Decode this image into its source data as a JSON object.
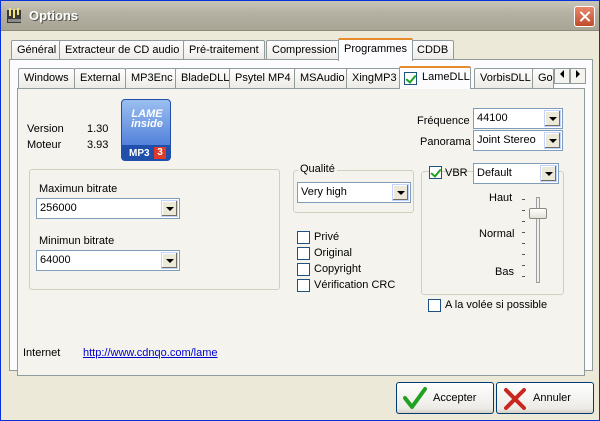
{
  "window": {
    "title": "Options"
  },
  "main_tabs": [
    "Général",
    "Extracteur de CD audio",
    "Pré-traitement",
    "Compression",
    "Programmes",
    "CDDB"
  ],
  "encoder_tabs": [
    "Windows",
    "External",
    "MP3Enc",
    "BladeDLL",
    "Psytel MP4",
    "MSAudio",
    "XingMP3",
    "LameDLL",
    "VorbisDLL",
    "Go"
  ],
  "info": {
    "version_label": "Version",
    "version_value": "1.30",
    "engine_label": "Moteur",
    "engine_value": "3.93"
  },
  "logo": {
    "text": "LAME inside",
    "mp3": "MP3",
    "num": "3"
  },
  "frequency": {
    "label": "Fréquence",
    "value": "44100"
  },
  "panorama": {
    "label": "Panorama",
    "value": "Joint Stereo"
  },
  "bitrate": {
    "max_label": "Maximun bitrate",
    "max_value": "256000",
    "min_label": "Minimun bitrate",
    "min_value": "64000"
  },
  "quality": {
    "label": "Qualité",
    "value": "Very high"
  },
  "options": {
    "private": "Privé",
    "original": "Original",
    "copyright": "Copyright",
    "crc": "Vérification CRC"
  },
  "vbr": {
    "label": "VBR",
    "value": "Default",
    "high": "Haut",
    "normal": "Normal",
    "low": "Bas",
    "level": 0.15
  },
  "on_the_fly": "A la volée si possible",
  "internet": {
    "label": "Internet",
    "url": "http://www.cdnqo.com/lame"
  },
  "buttons": {
    "accept": "Accepter",
    "cancel": "Annuler"
  },
  "colors": {
    "active_tab_accent": "#e68b2c",
    "link": "#0000cc",
    "accept_icon": "#21a121",
    "cancel_icon": "#c8281e"
  }
}
